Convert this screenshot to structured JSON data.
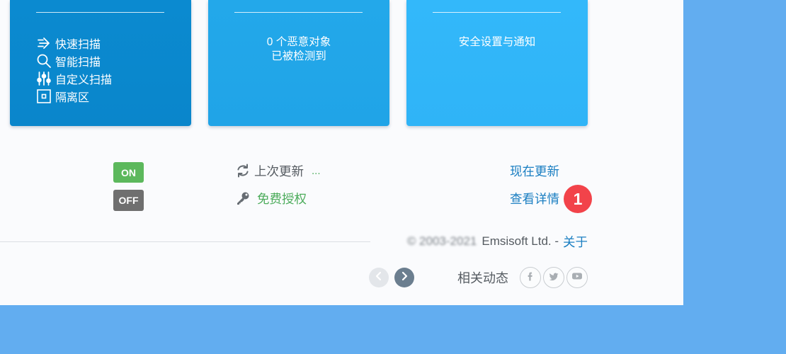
{
  "colors": {
    "page_bg": "#62adf0",
    "panel_bg": "#fafbfd",
    "card_scan": "#0a86cb",
    "card_detections": "#20a4e7",
    "card_settings": "#2fb4f7",
    "on_badge": "#5cb85c",
    "off_badge": "#6f6f6f",
    "link_blue": "#1b7fc2",
    "link_green": "#4dac5c",
    "text_gray": "#555b61",
    "alert_red": "#f2434a",
    "nav_dark": "#6b7e8f"
  },
  "cards": {
    "scan": {
      "items": [
        {
          "icon": "fast-scan-icon",
          "label": "快速扫描"
        },
        {
          "icon": "search-icon",
          "label": "智能扫描"
        },
        {
          "icon": "sliders-icon",
          "label": "自定义扫描"
        },
        {
          "icon": "quarantine-box-icon",
          "label": "隔离区"
        }
      ]
    },
    "detections": {
      "line1": "0 个恶意对象",
      "line2": "已被检测到"
    },
    "settings": {
      "line1": "安全设置与通知"
    }
  },
  "status": {
    "on_label": "ON",
    "off_label": "OFF",
    "last_update_icon": "refresh-icon",
    "last_update_label": "上次更新",
    "last_update_value": "...",
    "license_icon": "key-icon",
    "license_label": "免费授权",
    "update_now_link": "现在更新",
    "view_details_link": "查看详情",
    "alert_count": "1"
  },
  "footer": {
    "copyright": "© 2003-2021",
    "company": "Emsisoft Ltd. -",
    "about_link": "关于",
    "news_label": "相关动态",
    "nav_icons": [
      "chevron-left-icon",
      "chevron-right-icon"
    ],
    "social_icons": [
      "facebook-icon",
      "twitter-icon",
      "youtube-icon"
    ]
  }
}
